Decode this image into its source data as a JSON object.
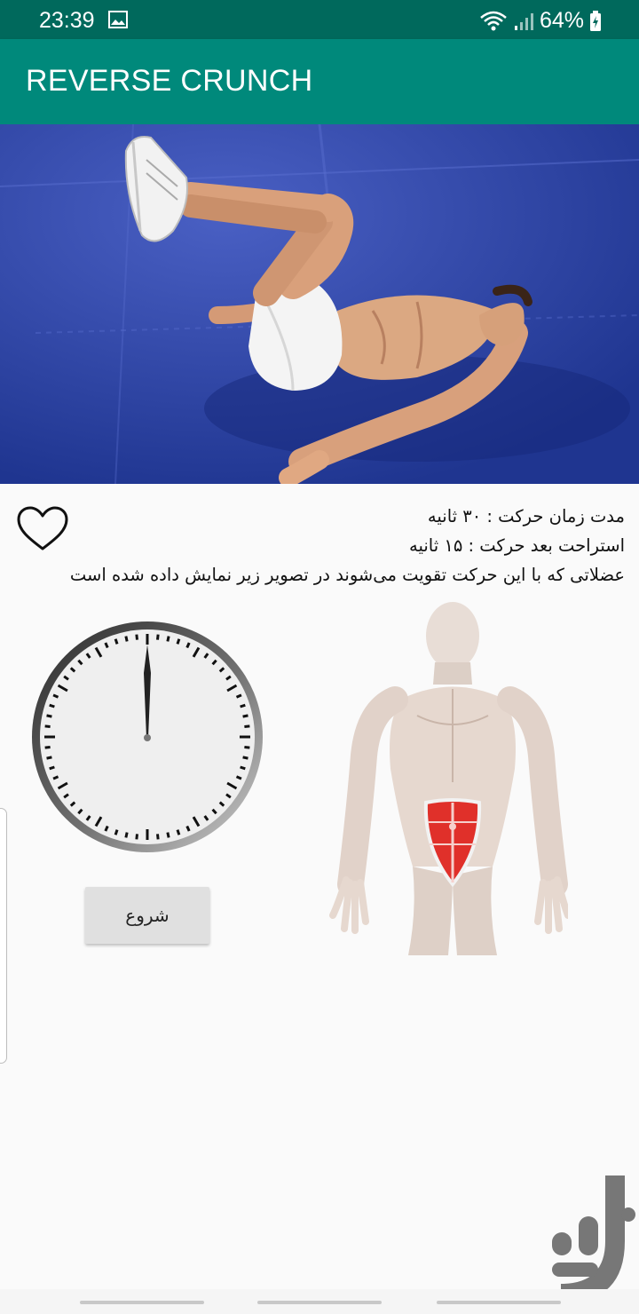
{
  "status_bar": {
    "time": "23:39",
    "battery": "64%",
    "icons": [
      "gallery-icon",
      "wifi-icon",
      "signal-icon",
      "battery-charging-icon"
    ]
  },
  "app_bar": {
    "title": "REVERSE CRUNCH"
  },
  "exercise": {
    "duration_text": "مدت زمان حرکت : ۳۰ ثانیه",
    "rest_text": "استراحت بعد حرکت : ۱۵ ثانیه",
    "muscles_text": "عضلاتی که با این حرکت تقویت می‌شوند در تصویر زیر نمایش داده شده است"
  },
  "favorite": {
    "icon": "heart-outline-icon"
  },
  "stopwatch": {
    "hand_value": 0
  },
  "start_button": {
    "label": "شروع"
  },
  "colors": {
    "status_bar": "#00695c",
    "app_bar": "#00897b",
    "mat": "#2a41a6",
    "muscle_highlight": "#e0302a"
  }
}
